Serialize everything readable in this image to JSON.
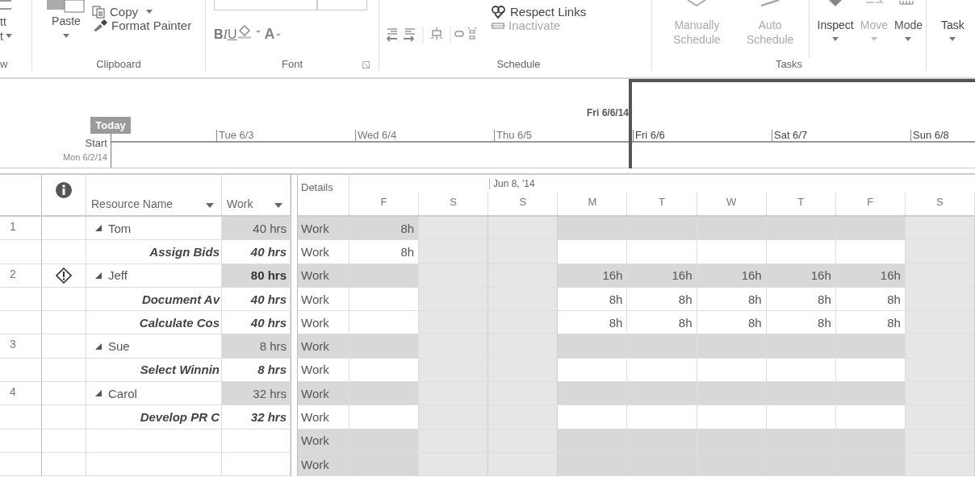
{
  "ribbon": {
    "groups": [
      {
        "kind": "view",
        "label": "w",
        "items": [
          {
            "label": "tt",
            "disabled": false
          },
          {
            "label": "t",
            "disabled": false
          }
        ]
      },
      {
        "kind": "clipboard",
        "label": "Clipboard",
        "items": [
          {
            "label": "Paste",
            "disabled": false
          },
          {
            "label": "Copy",
            "disabled": false
          },
          {
            "label": "Format Painter",
            "disabled": false
          }
        ]
      },
      {
        "kind": "font",
        "label": "Font",
        "items": [
          {
            "label": "B",
            "disabled": false
          },
          {
            "label": "I",
            "disabled": false
          },
          {
            "label": "U",
            "disabled": false
          },
          {
            "label": "A",
            "disabled": false
          }
        ]
      },
      {
        "kind": "schedule",
        "label": "Schedule",
        "items": [
          {
            "label": "Respect Links",
            "disabled": false
          },
          {
            "label": "Inactivate",
            "disabled": true
          }
        ]
      },
      {
        "kind": "tasks",
        "label": "Tasks",
        "items": [
          {
            "label": "Manually Schedule",
            "disabled": true
          },
          {
            "label": "Auto Schedule",
            "disabled": true
          },
          {
            "label": "Inspect",
            "disabled": false
          },
          {
            "label": "Move",
            "disabled": true
          },
          {
            "label": "Mode",
            "disabled": false
          }
        ]
      },
      {
        "kind": "insert",
        "items": [
          {
            "label": "Task",
            "disabled": false
          }
        ]
      }
    ]
  },
  "timeline": {
    "today_label": "Today",
    "start_label": "Start",
    "start_date": "Mon 6/2/14",
    "marker_date": "Fri 6/6/14",
    "days": [
      {
        "label": "Tue 6/3",
        "in_view": false
      },
      {
        "label": "Wed 6/4",
        "in_view": false
      },
      {
        "label": "Thu 6/5",
        "in_view": false
      },
      {
        "label": "Fri 6/6",
        "in_view": true
      },
      {
        "label": "Sat 6/7",
        "in_view": true
      },
      {
        "label": "Sun 6/8",
        "in_view": true
      }
    ]
  },
  "sheet": {
    "columns": {
      "name": "Resource Name",
      "work": "Work"
    },
    "resources": [
      {
        "id": "1",
        "name": "Tom",
        "work": "40 hrs",
        "overallocated": false,
        "expanded": true,
        "detail": "Work",
        "hours": {
          "0": "8h"
        },
        "children": [
          {
            "name": "Assign Bids",
            "work": "40 hrs",
            "detail": "Work",
            "hours": {
              "0": "8h"
            }
          }
        ]
      },
      {
        "id": "2",
        "name": "Jeff",
        "work": "80 hrs",
        "overallocated": true,
        "expanded": true,
        "detail": "Work",
        "hours": {
          "3": "16h",
          "4": "16h",
          "5": "16h",
          "6": "16h",
          "7": "16h"
        },
        "children": [
          {
            "name": "Document Av",
            "work": "40 hrs",
            "detail": "Work",
            "hours": {
              "3": "8h",
              "4": "8h",
              "5": "8h",
              "6": "8h",
              "7": "8h"
            }
          },
          {
            "name": "Calculate Cos",
            "work": "40 hrs",
            "detail": "Work",
            "hours": {
              "3": "8h",
              "4": "8h",
              "5": "8h",
              "6": "8h",
              "7": "8h"
            }
          }
        ]
      },
      {
        "id": "3",
        "name": "Sue",
        "work": "8 hrs",
        "overallocated": false,
        "expanded": true,
        "detail": "Work",
        "children": [
          {
            "name": "Select Winnin",
            "work": "8 hrs",
            "detail": "Work"
          }
        ]
      },
      {
        "id": "4",
        "name": "Carol",
        "work": "32 hrs",
        "overallocated": false,
        "expanded": true,
        "detail": "Work",
        "children": [
          {
            "name": "Develop PR C",
            "work": "32 hrs",
            "detail": "Work"
          }
        ]
      }
    ],
    "blank_rows": [
      {
        "detail": "Work"
      },
      {
        "detail": "Work"
      }
    ]
  },
  "usage": {
    "details_label": "Details",
    "week_label": "Jun 8, '14",
    "days": [
      {
        "letter": "F",
        "weekend": false
      },
      {
        "letter": "S",
        "weekend": true
      },
      {
        "letter": "S",
        "weekend": true
      },
      {
        "letter": "M",
        "weekend": false
      },
      {
        "letter": "T",
        "weekend": false
      },
      {
        "letter": "W",
        "weekend": false
      },
      {
        "letter": "T",
        "weekend": false
      },
      {
        "letter": "F",
        "weekend": false
      },
      {
        "letter": "S",
        "weekend": true
      }
    ]
  }
}
